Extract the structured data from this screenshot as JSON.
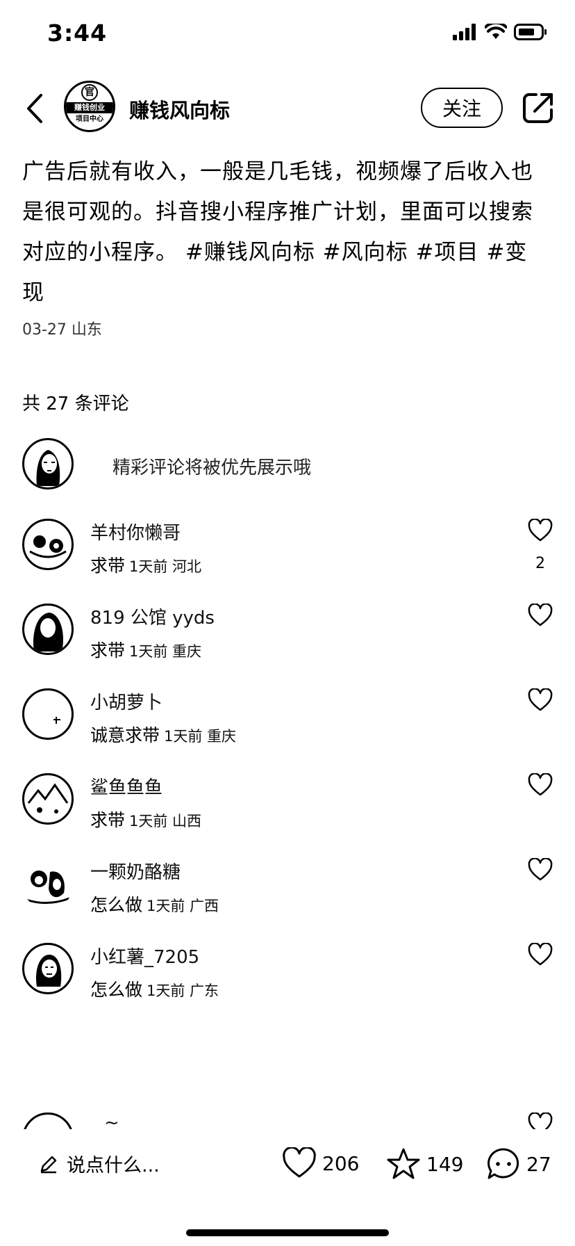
{
  "status_bar": {
    "time": "3:44",
    "icons": [
      "signal-icon",
      "wifi-icon",
      "battery-icon"
    ]
  },
  "header": {
    "back_icon": "chevron-left-icon",
    "author_name": "赚钱风向标",
    "avatar_text_top": "官",
    "avatar_text_mid": "赚钱创业",
    "avatar_text_bottom": "项目中心",
    "follow_label": "关注",
    "share_icon": "share-icon"
  },
  "post": {
    "lines": [
      "广告后就有收入，一般是几毛钱，视频爆了后收入也",
      "是很可观的。抖音搜小程序推广计划，里面可以搜索",
      "对应的小程序。 #赚钱风向标  #风向标  #项目  #变",
      "现"
    ],
    "date_location": "03-27 山东"
  },
  "comments_section": {
    "count_label": "共 27 条评论",
    "prompt": "精彩评论将被优先展示哦",
    "comments": [
      {
        "name": "羊村你懒哥",
        "text": "求带",
        "meta": "1天前 河北",
        "likes": "2"
      },
      {
        "name": "819 公馆 yyds",
        "text": "求带",
        "meta": "1天前 重庆",
        "likes": ""
      },
      {
        "name": "小胡萝卜",
        "text": "诚意求带",
        "meta": "1天前 重庆",
        "likes": ""
      },
      {
        "name": "鲨鱼鱼鱼",
        "text": "求带",
        "meta": "1天前 山西",
        "likes": ""
      },
      {
        "name": "一颗奶酪糖",
        "text": "怎么做",
        "meta": "1天前 广西",
        "likes": ""
      },
      {
        "name": "小红薯_7205",
        "text": "怎么做",
        "meta": "1天前 广东",
        "likes": ""
      },
      {
        "name": "~",
        "text": "",
        "meta": "",
        "likes": ""
      }
    ]
  },
  "bottom_bar": {
    "input_placeholder": "说点什么...",
    "likes": "206",
    "favorites": "149",
    "comments": "27"
  }
}
